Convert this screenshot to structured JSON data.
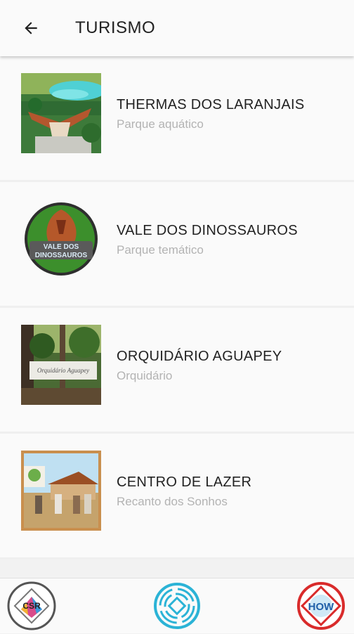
{
  "appbar": {
    "title": "TURISMO",
    "back_icon": "arrow-left-icon"
  },
  "items": [
    {
      "name": "THERMAS DOS LARANJAIS",
      "subtitle": "Parque aquático"
    },
    {
      "name": "VALE DOS DINOSSAUROS",
      "subtitle": "Parque temático",
      "logo_text_1": "VALE DOS",
      "logo_text_2": "DINOSSAUROS"
    },
    {
      "name": "ORQUIDÁRIO AGUAPEY",
      "subtitle": "Orquidário",
      "sign_text": "Orquidário Aguapey"
    },
    {
      "name": "CENTRO DE LAZER",
      "subtitle": "Recanto dos Sonhos"
    }
  ],
  "bottom": {
    "left_logo_text": "CSR",
    "right_logo_text": "HOW"
  },
  "colors": {
    "accent": "#2bb3d6",
    "title": "#222222",
    "subtitle": "#b3b3b3"
  }
}
